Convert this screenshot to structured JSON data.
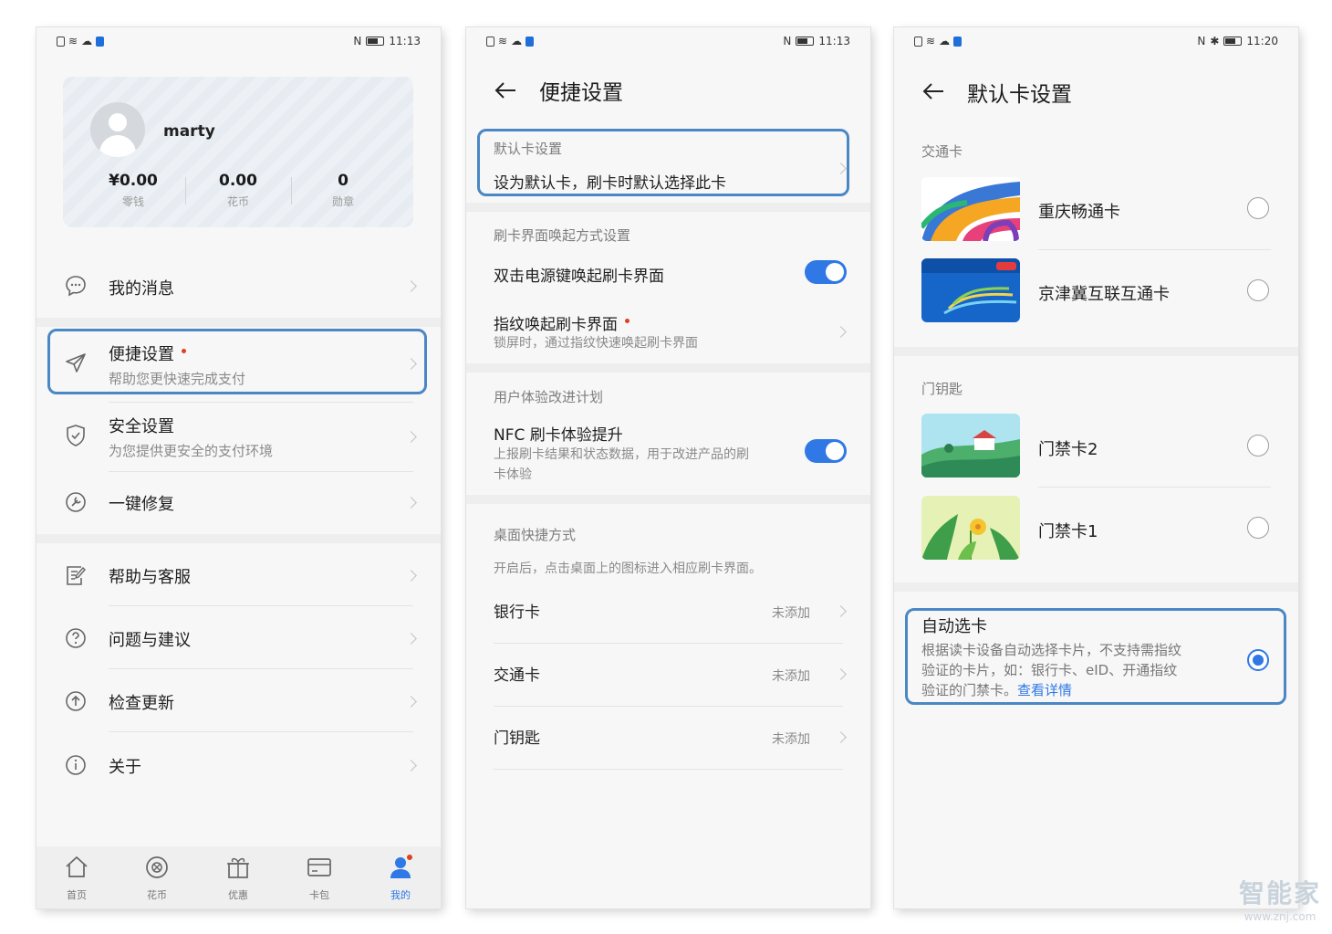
{
  "status_bars": {
    "s1_time": "11:13",
    "s2_time": "11:13",
    "s3_time": "11:20"
  },
  "screen1": {
    "profile": {
      "username": "marty",
      "stats": [
        {
          "value": "¥0.00",
          "label": "零钱"
        },
        {
          "value": "0.00",
          "label": "花币"
        },
        {
          "value": "0",
          "label": "勋章"
        }
      ]
    },
    "menu": {
      "messages": "我的消息",
      "shortcut_title": "便捷设置",
      "shortcut_sub": "帮助您更快速完成支付",
      "security_title": "安全设置",
      "security_sub": "为您提供更安全的支付环境",
      "repair": "一键修复",
      "help": "帮助与客服",
      "feedback": "问题与建议",
      "update": "检查更新",
      "about": "关于"
    },
    "nav": [
      "首页",
      "花币",
      "优惠",
      "卡包",
      "我的"
    ]
  },
  "screen2": {
    "title": "便捷设置",
    "default_card_label": "默认卡设置",
    "default_card_desc": "设为默认卡，刷卡时默认选择此卡",
    "wake_section": "刷卡界面唤起方式设置",
    "double_click": "双击电源键唤起刷卡界面",
    "fingerprint_title": "指纹唤起刷卡界面",
    "fingerprint_sub": "锁屏时，通过指纹快速唤起刷卡界面",
    "ux_section": "用户体验改进计划",
    "nfc_title": "NFC 刷卡体验提升",
    "nfc_sub_1": "上报刷卡结果和状态数据，用于改进产品的刷",
    "nfc_sub_2": "卡体验",
    "desktop_section": "桌面快捷方式",
    "desktop_desc": "开启后，点击桌面上的图标进入相应刷卡界面。",
    "shortcuts": [
      {
        "name": "银行卡",
        "status": "未添加"
      },
      {
        "name": "交通卡",
        "status": "未添加"
      },
      {
        "name": "门钥匙",
        "status": "未添加"
      }
    ]
  },
  "screen3": {
    "title": "默认卡设置",
    "transit_section": "交通卡",
    "transit_cards": [
      "重庆畅通卡",
      "京津冀互联互通卡"
    ],
    "key_section": "门钥匙",
    "key_cards": [
      "门禁卡2",
      "门禁卡1"
    ],
    "auto_title": "自动选卡",
    "auto_desc_1": "根据读卡设备自动选择卡片，不支持需指纹",
    "auto_desc_2": "验证的卡片，如：银行卡、eID、开通指纹",
    "auto_desc_3": "验证的门禁卡。",
    "auto_link": "查看详情"
  },
  "watermark": {
    "text": "智能家",
    "url": "www.znj.com"
  },
  "colors": {
    "accent": "#2f78e5",
    "highlight": "#4a87c4"
  }
}
